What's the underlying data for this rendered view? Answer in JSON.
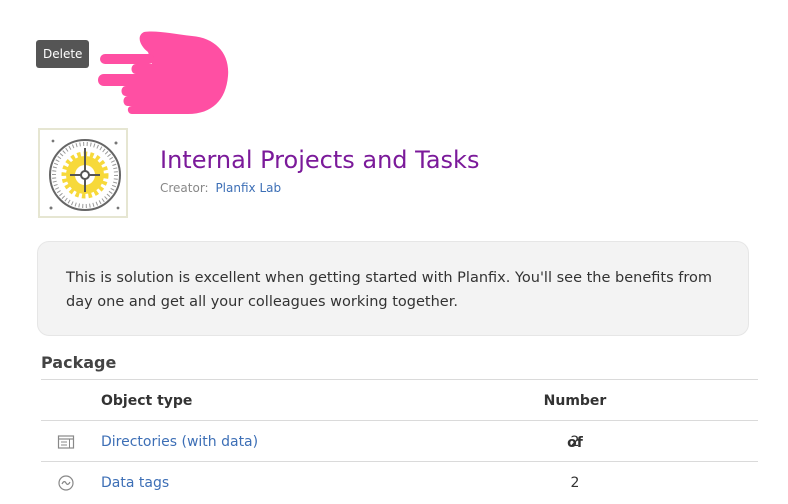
{
  "tooltip": {
    "label": "Delete"
  },
  "header": {
    "title": "Internal Projects and Tasks",
    "creator_label": "Creator:",
    "creator_name": "Planfix Lab"
  },
  "description": "This is solution  is excellent when getting started with Planfix. You'll see the benefits from day one and get all your colleagues working together.",
  "package": {
    "title": "Package",
    "columns": {
      "type": "Object type",
      "count": "Number of"
    },
    "rows": [
      {
        "icon": "directory-icon",
        "type": "Directories (with data)",
        "count": "2"
      },
      {
        "icon": "data-tag-icon",
        "type": "Data tags",
        "count": "2"
      }
    ]
  },
  "colors": {
    "title": "#7b1a9a",
    "link": "#3d6fb6",
    "hand": "#ff4fa3"
  }
}
